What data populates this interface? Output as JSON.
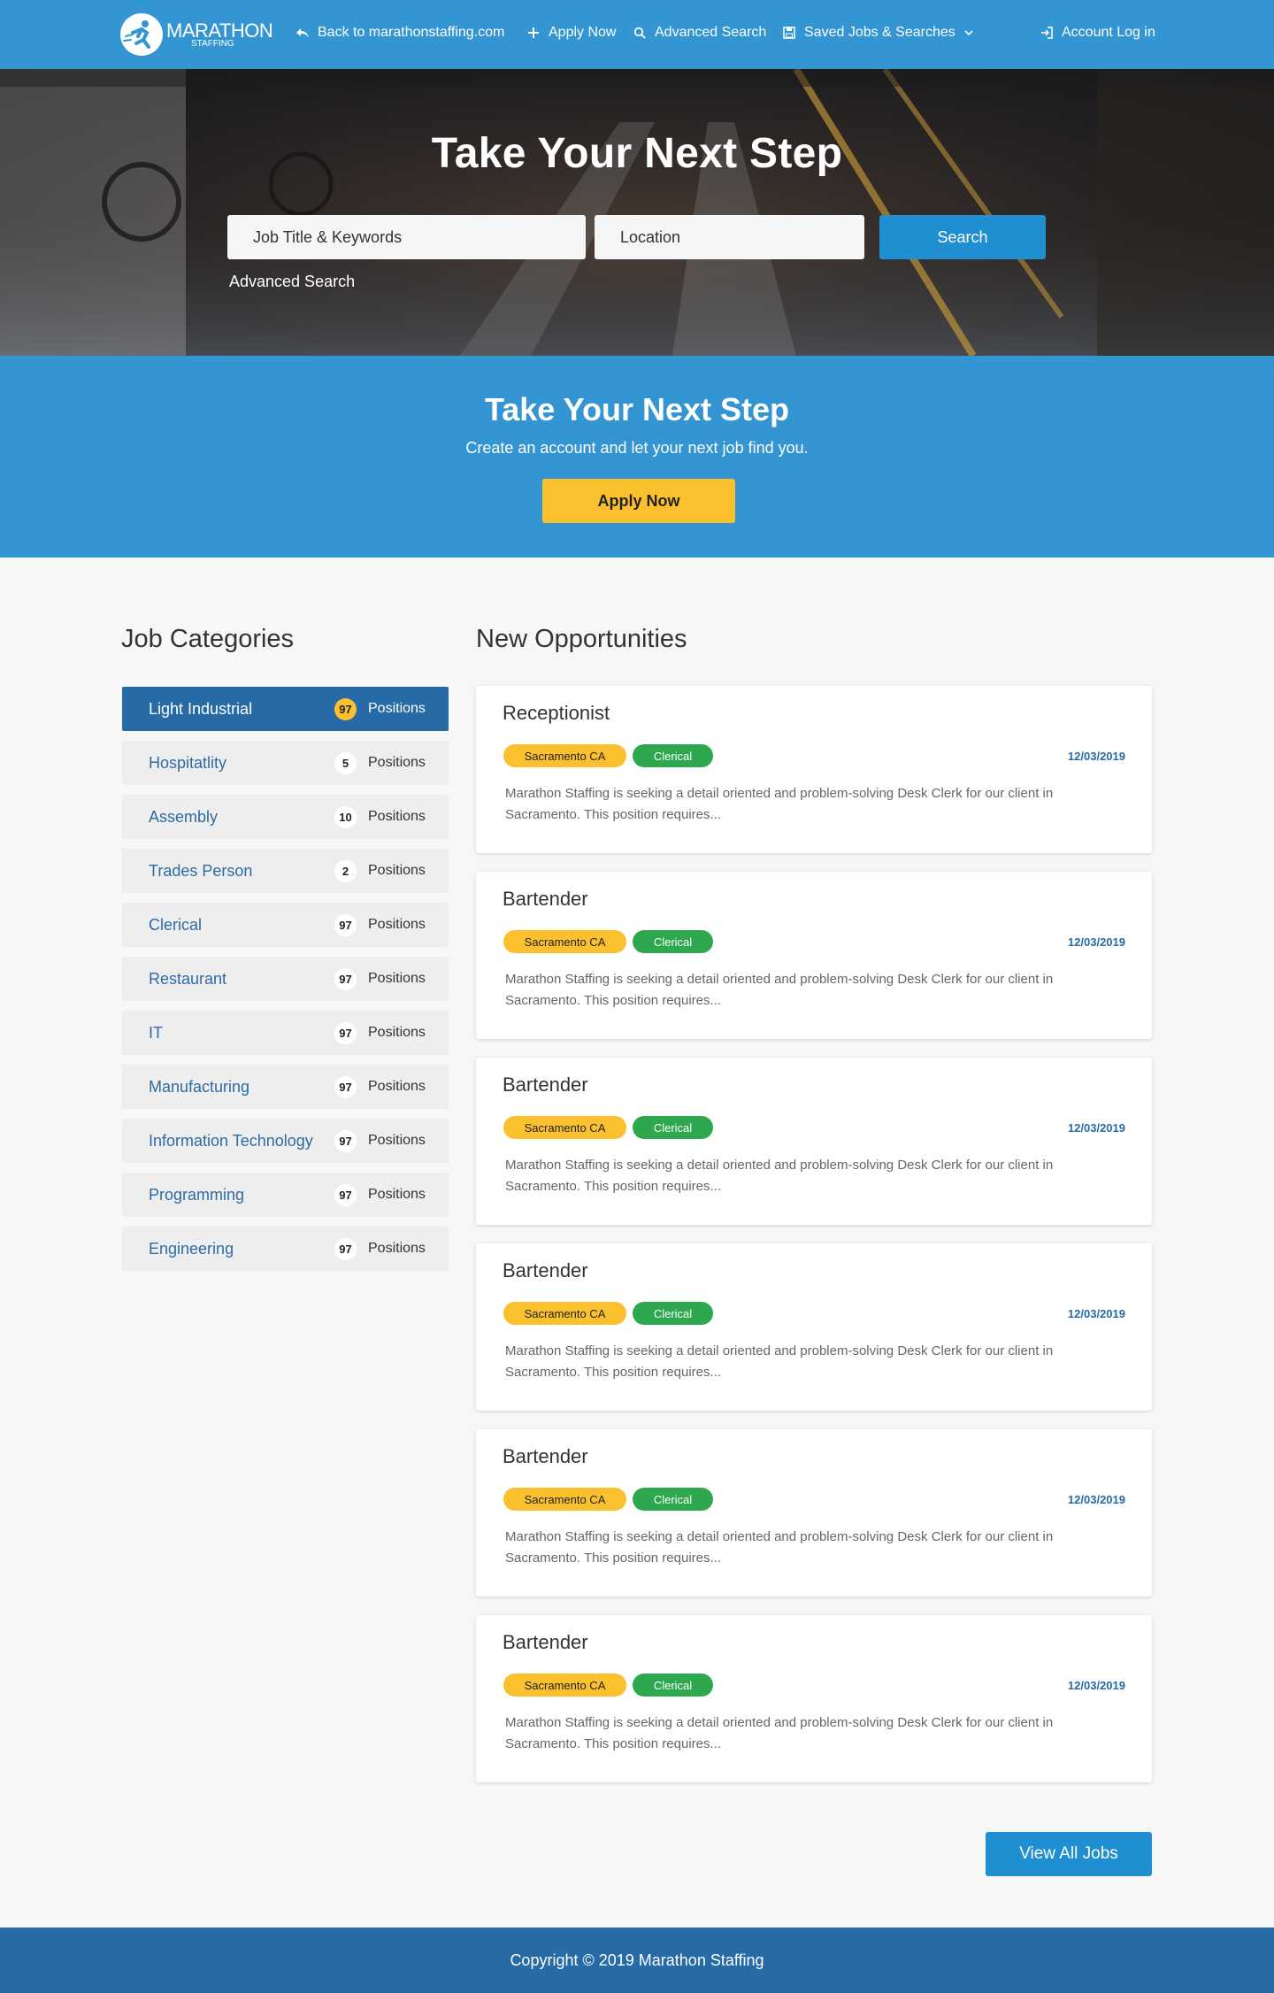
{
  "nav": {
    "logo_main": "MARATHON",
    "logo_sub": "STAFFING",
    "back_link": "Back to marathonstaffing.com",
    "apply_now": "Apply Now",
    "advanced_search": "Advanced Search",
    "saved_jobs": "Saved Jobs & Searches",
    "account_login": "Account Log in",
    "icons": [
      "reply-arrow-icon",
      "plus-icon",
      "search-icon",
      "floppy-disk-icon",
      "chevron-down-icon",
      "login-icon"
    ]
  },
  "hero": {
    "title": "Take Your Next Step",
    "keywords_placeholder": "Job Title & Keywords",
    "location_placeholder": "Location",
    "search_label": "Search",
    "advanced_search_label": "Advanced Search"
  },
  "cta": {
    "title": "Take Your Next Step",
    "subtitle": "Create an account and let your next job find you.",
    "button_label": "Apply Now"
  },
  "categories": {
    "heading": "Job Categories",
    "positions_label": "Positions",
    "items": [
      {
        "name": "Light Industrial",
        "count": "97",
        "active": true
      },
      {
        "name": "Hospitatlity",
        "count": "5"
      },
      {
        "name": "Assembly",
        "count": "10"
      },
      {
        "name": "Trades Person",
        "count": "2"
      },
      {
        "name": "Clerical",
        "count": "97"
      },
      {
        "name": "Restaurant",
        "count": "97"
      },
      {
        "name": "IT",
        "count": "97"
      },
      {
        "name": "Manufacturing",
        "count": "97"
      },
      {
        "name": "Information Technology",
        "count": "97"
      },
      {
        "name": "Programming",
        "count": "97"
      },
      {
        "name": "Engineering",
        "count": "97"
      }
    ]
  },
  "opportunities": {
    "heading": "New Opportunities",
    "jobs": [
      {
        "title": "Receptionist",
        "location": "Sacramento CA",
        "category": "Clerical",
        "date": "12/03/2019",
        "description": "Marathon Staffing is seeking a detail oriented and problem-solving Desk Clerk for our client in Sacramento. This position requires..."
      },
      {
        "title": "Bartender",
        "location": "Sacramento CA",
        "category": "Clerical",
        "date": "12/03/2019",
        "description": "Marathon Staffing is seeking a detail oriented and problem-solving Desk Clerk for our client in Sacramento. This position requires..."
      },
      {
        "title": "Bartender",
        "location": "Sacramento CA",
        "category": "Clerical",
        "date": "12/03/2019",
        "description": "Marathon Staffing is seeking a detail oriented and problem-solving Desk Clerk for our client in Sacramento. This position requires..."
      },
      {
        "title": "Bartender",
        "location": "Sacramento CA",
        "category": "Clerical",
        "date": "12/03/2019",
        "description": "Marathon Staffing is seeking a detail oriented and problem-solving Desk Clerk for our client in Sacramento. This position requires..."
      },
      {
        "title": "Bartender",
        "location": "Sacramento CA",
        "category": "Clerical",
        "date": "12/03/2019",
        "description": "Marathon Staffing is seeking a detail oriented and problem-solving Desk Clerk for our client in Sacramento. This position requires..."
      },
      {
        "title": "Bartender",
        "location": "Sacramento CA",
        "category": "Clerical",
        "date": "12/03/2019",
        "description": "Marathon Staffing is seeking a detail oriented and problem-solving Desk Clerk for our client in Sacramento. This position requires..."
      }
    ],
    "view_all_label": "View All Jobs"
  },
  "footer": {
    "copyright": "Copyright © 2019 Marathon Staffing"
  },
  "colors": {
    "primary_blue": "#3396d3",
    "dark_blue": "#266aa6",
    "button_blue": "#1f8fd1",
    "yellow": "#fbc02d",
    "green": "#2ea84f"
  }
}
